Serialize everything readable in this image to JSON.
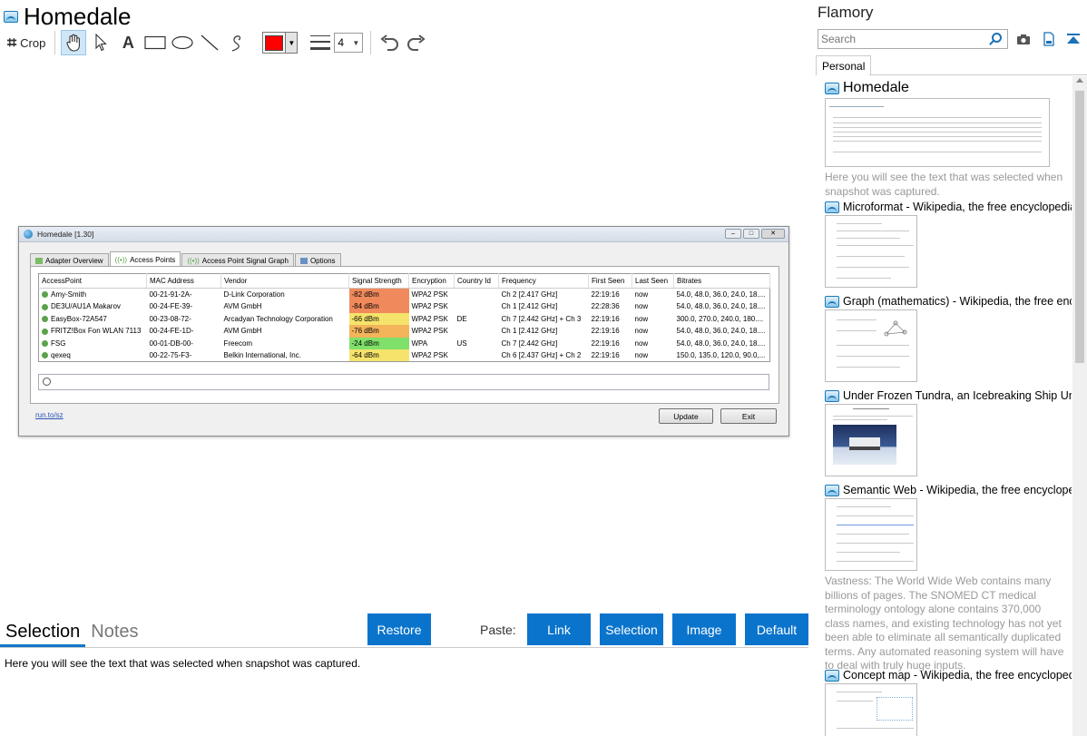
{
  "header": {
    "title": "Homedale"
  },
  "toolbar": {
    "crop_label": "Crop",
    "tools": [
      "hand-tool",
      "pointer-tool",
      "text-tool",
      "rectangle-tool",
      "ellipse-tool",
      "line-tool",
      "pen-tool"
    ],
    "text_tool_glyph": "A",
    "color": "#ff0000",
    "line_width": "4"
  },
  "snapshot": {
    "window_title": "Homedale [1.30]",
    "tabs": [
      "Adapter Overview",
      "Access Points",
      "Access Point Signal Graph",
      "Options"
    ],
    "active_tab": "Access Points",
    "columns": [
      "AccessPoint",
      "MAC Address",
      "Vendor",
      "Signal Strength",
      "Encryption",
      "Country Id",
      "Frequency",
      "First Seen",
      "Last Seen",
      "Bitrates"
    ],
    "rows": [
      {
        "name": "Amy-Smith",
        "mac": "00-21-91-2A-",
        "vendor": "D-Link Corporation",
        "signal": "-82 dBm",
        "signal_color": "#f08a5d",
        "enc": "WPA2 PSK",
        "country": "",
        "freq": "Ch 2 [2.417 GHz]",
        "first": "22:19:16",
        "last": "now",
        "bitrates": "54.0, 48.0, 36.0, 24.0, 18...."
      },
      {
        "name": "DE3U/AU1A Makarov",
        "mac": "00-24-FE-39-",
        "vendor": "AVM GmbH",
        "signal": "-84 dBm",
        "signal_color": "#f08a5d",
        "enc": "WPA2 PSK",
        "country": "",
        "freq": "Ch 1 [2.412 GHz]",
        "first": "22:28:36",
        "last": "now",
        "bitrates": "54.0, 48.0, 36.0, 24.0, 18...."
      },
      {
        "name": "EasyBox-72A547",
        "mac": "00-23-08-72-",
        "vendor": "Arcadyan Technology Corporation",
        "signal": "-66 dBm",
        "signal_color": "#f5e36b",
        "enc": "WPA2 PSK",
        "country": "DE",
        "freq": "Ch 7 [2.442 GHz] + Ch 3",
        "first": "22:19:16",
        "last": "now",
        "bitrates": "300.0, 270.0, 240.0, 180...."
      },
      {
        "name": "FRITZ!Box Fon WLAN 7113",
        "mac": "00-24-FE-1D-",
        "vendor": "AVM GmbH",
        "signal": "-76 dBm",
        "signal_color": "#f3b45a",
        "enc": "WPA2 PSK",
        "country": "",
        "freq": "Ch 1 [2.412 GHz]",
        "first": "22:19:16",
        "last": "now",
        "bitrates": "54.0, 48.0, 36.0, 24.0, 18...."
      },
      {
        "name": "FSG",
        "mac": "00-01-DB-00-",
        "vendor": "Freecom",
        "signal": "-24 dBm",
        "signal_color": "#7fe06a",
        "enc": "WPA",
        "country": "US",
        "freq": "Ch 7 [2.442 GHz]",
        "first": "22:19:16",
        "last": "now",
        "bitrates": "54.0, 48.0, 36.0, 24.0, 18...."
      },
      {
        "name": "qexeq",
        "mac": "00-22-75-F3-",
        "vendor": "Belkin International, Inc.",
        "signal": "-64 dBm",
        "signal_color": "#f5e36b",
        "enc": "WPA2 PSK",
        "country": "",
        "freq": "Ch 6 [2.437 GHz] + Ch 2",
        "first": "22:19:16",
        "last": "now",
        "bitrates": "150.0, 135.0, 120.0, 90.0,..."
      }
    ],
    "link": "run.to/sz",
    "update_label": "Update",
    "exit_label": "Exit"
  },
  "bottom": {
    "tabs": [
      "Selection",
      "Notes"
    ],
    "active_tab": "Selection",
    "restore_label": "Restore",
    "paste_label": "Paste:",
    "paste_buttons": [
      "Link",
      "Selection",
      "Image",
      "Default"
    ],
    "selection_text": "Here you will see the text that was selected when snapshot was captured."
  },
  "panel": {
    "title": "Flamory",
    "search_placeholder": "Search",
    "tab": "Personal",
    "entries": [
      {
        "title": "Homedale",
        "description": "Here you will see the text that was selected when snapshot was captured."
      },
      {
        "title": "Microformat - Wikipedia, the free encyclopedia",
        "description": ""
      },
      {
        "title": "Graph (mathematics) - Wikipedia, the free encyclopedia",
        "description": ""
      },
      {
        "title": "Under Frozen Tundra, an Icebreaking Ship Uncovers",
        "description": ""
      },
      {
        "title": "Semantic Web - Wikipedia, the free encyclopedia",
        "description": "Vastness: The World Wide Web contains many billions of pages. The SNOMED CT medical terminology ontology alone contains 370,000 class names, and existing technology has not yet been able to eliminate all semantically duplicated terms. Any automated reasoning system will have to deal with truly huge inputs."
      },
      {
        "title": "Concept map - Wikipedia, the free encyclopedia",
        "description": ""
      }
    ]
  },
  "colors": {
    "accent": "#0a74cc",
    "tab_underline": "#1177cc"
  }
}
